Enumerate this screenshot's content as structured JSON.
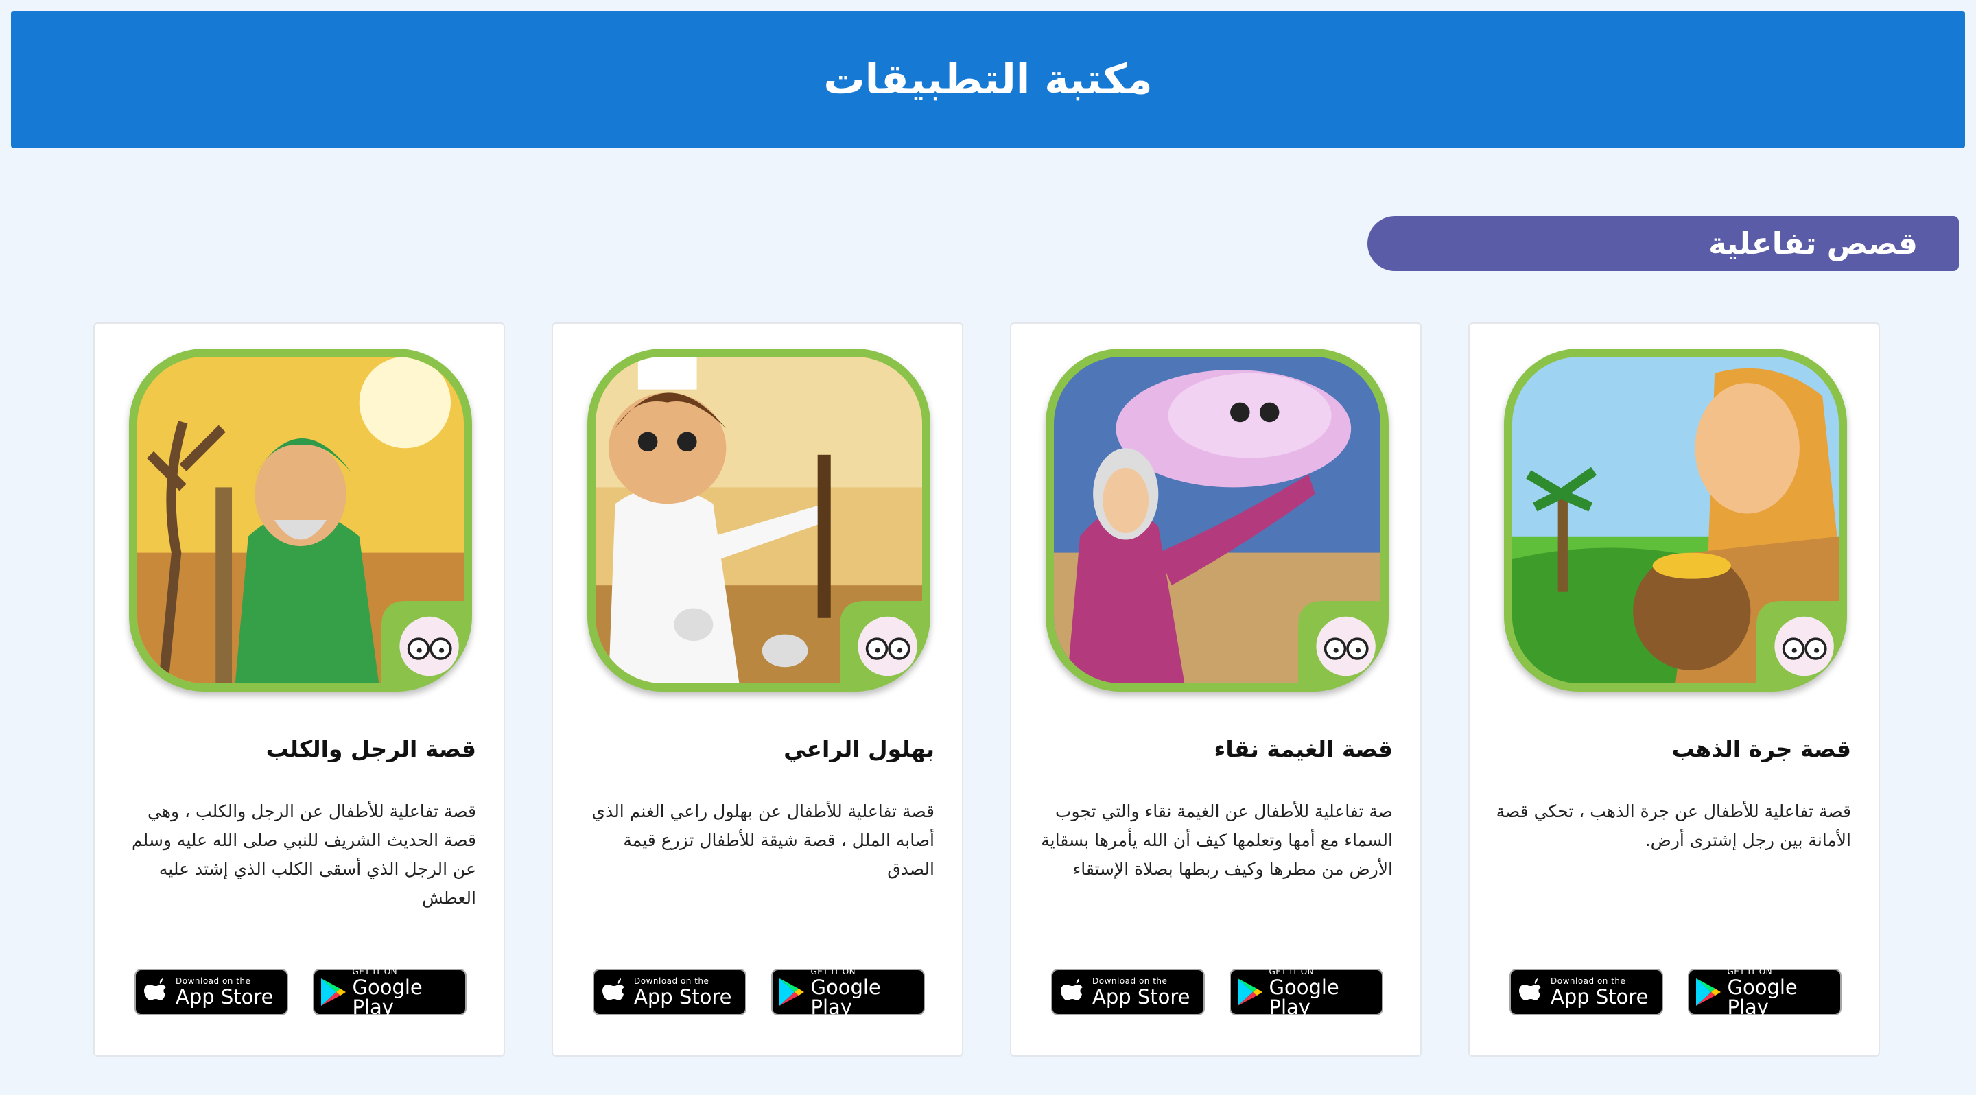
{
  "header": {
    "title": "مكتبة التطبيقات"
  },
  "section": {
    "title": "قصص تفاعلية"
  },
  "apps": [
    {
      "title": "قصة جرة الذهب",
      "description": "قصة تفاعلية للأطفال عن جرة الذهب ، تحكي قصة الأمانة بين رجل إشترى أرض.",
      "appstore_small": "Download on the",
      "appstore_big": "App Store",
      "play_small": "GET IT ON",
      "play_big": "Google Play"
    },
    {
      "title": "قصة الغيمة نقاء",
      "description": "صة تفاعلية للأطفال عن الغيمة نقاء والتي تجوب السماء مع أمها وتعلمها كيف أن الله يأمرها بسقاية الأرض من مطرها وكيف ربطها بصلاة الإستقاء",
      "appstore_small": "Download on the",
      "appstore_big": "App Store",
      "play_small": "GET IT ON",
      "play_big": "Google Play"
    },
    {
      "title": "بهلول الراعي",
      "description": "قصة تفاعلية للأطفال عن بهلول راعي الغنم الذي أصابه الملل ، قصة شيقة للأطفال تزرع قيمة الصدق",
      "appstore_small": "Download on the",
      "appstore_big": "App Store",
      "play_small": "GET IT ON",
      "play_big": "Google Play"
    },
    {
      "title": "قصة الرجل والكلب",
      "description": "قصة تفاعلية للأطفال عن الرجل والكلب ، وهي قصة الحديث الشريف للنبي صلى الله عليه وسلم عن الرجل الذي أسقى الكلب الذي إشتد عليه العطش",
      "appstore_small": "Download on the",
      "appstore_big": "App Store",
      "play_small": "GET IT ON",
      "play_big": "Google Play"
    }
  ],
  "colors": {
    "header": "#1679d4",
    "section_pill": "#5a5ca7",
    "icon_frame": "#8bc34a"
  }
}
